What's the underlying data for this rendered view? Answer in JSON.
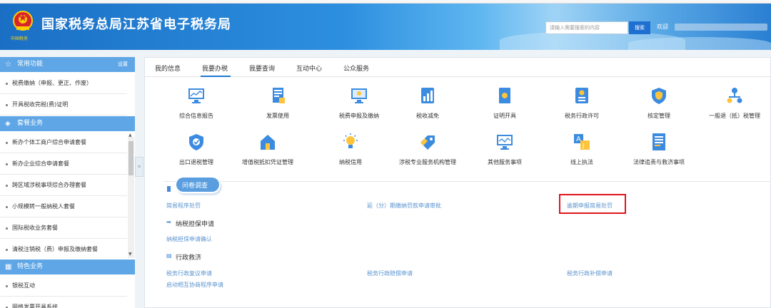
{
  "header": {
    "emblem_caption": "中国税务",
    "site_title": "国家税务总局江苏省电子税务局",
    "search_placeholder": "请输入需要搜索的内容",
    "search_button": "搜索",
    "welcome": "欢迎"
  },
  "sidebar": {
    "sections": [
      {
        "label": "常用功能",
        "icon": "star-icon",
        "setting": "设置"
      },
      {
        "label": "套餐业务",
        "icon": "layers-icon"
      },
      {
        "label": "特色业务",
        "icon": "grid-icon"
      }
    ],
    "common_items": [
      "税费缴纳（申报、更正、作废）",
      "开具税收完税(费)证明"
    ],
    "package_items": [
      "新办个体工商户综合申请套餐",
      "新办企业综合申请套餐",
      "跨区域涉税事项综合办理套餐",
      "小规模转一般纳税人套餐",
      "国际税收业务套餐",
      "清税注销税（费）申报及缴纳套餐"
    ],
    "feature_items": [
      "银税互动",
      "网络发票开具系统"
    ]
  },
  "main": {
    "tabs": [
      "我的信息",
      "我要办税",
      "我要查询",
      "互动中心",
      "公众服务"
    ],
    "active_tab": "我要办税",
    "grid_row1": [
      {
        "label": "综合信息报告",
        "icon": "monitor-chart-icon"
      },
      {
        "label": "发票使用",
        "icon": "invoice-icon"
      },
      {
        "label": "税费申报及缴纳",
        "icon": "screen-icon"
      },
      {
        "label": "税收减免",
        "icon": "bar-chart-icon"
      },
      {
        "label": "证明开具",
        "icon": "certificate-icon"
      },
      {
        "label": "税务行政许可",
        "icon": "id-card-icon"
      },
      {
        "label": "核定管理",
        "icon": "shield-icon"
      },
      {
        "label": "一般退（抵）税管理",
        "icon": "org-chart-icon"
      }
    ],
    "grid_row2": [
      {
        "label": "出口退税管理",
        "icon": "shield-check-icon"
      },
      {
        "label": "增值税抵扣凭证管理",
        "icon": "house-icon"
      },
      {
        "label": "纳税信用",
        "icon": "lightbulb-icon"
      },
      {
        "label": "涉税专业服务机构管理",
        "icon": "tag-icon"
      },
      {
        "label": "其他服务事项",
        "icon": "monitor-line-icon"
      },
      {
        "label": "线上执法",
        "icon": "translate-icon"
      },
      {
        "label": "法律追责与救济事项",
        "icon": "document-icon"
      }
    ],
    "survey_label": "问卷调查",
    "legal_links": {
      "row1": [
        "简易程序处罚",
        "延（分）期缴纳罚款申请审批",
        "逾期申报简易处罚"
      ]
    },
    "guarantee": {
      "title": "纳税担保申请",
      "links": [
        "纳税担保申请确认"
      ]
    },
    "remedy": {
      "title": "行政救济",
      "links_row1": [
        "税务行政复议申请",
        "税务行政赔偿申请",
        "税务行政补偿申请"
      ],
      "links_row2": [
        "启动相互协商程序申请"
      ]
    },
    "colors": {
      "accent": "#1f78d1",
      "link": "#5a93cf",
      "highlight": "#e0141e",
      "sidebar_header": "#5ea6e6"
    }
  }
}
